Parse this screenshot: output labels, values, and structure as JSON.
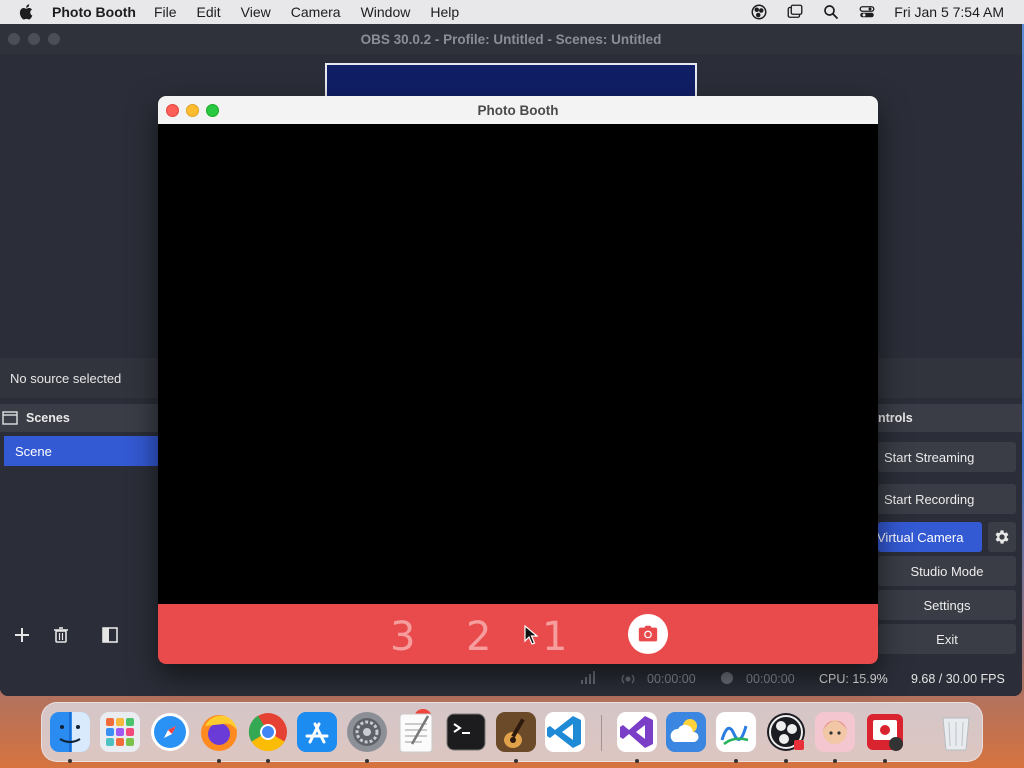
{
  "menubar": {
    "app_name": "Photo Booth",
    "items": [
      "File",
      "Edit",
      "View",
      "Camera",
      "Window",
      "Help"
    ],
    "datetime": "Fri Jan 5  7:54 AM"
  },
  "obs": {
    "title": "OBS 30.0.2 - Profile: Untitled - Scenes: Untitled",
    "no_source": "No source selected",
    "scenes_header": "Scenes",
    "scene_item": "Scene",
    "controls_header": "ntrols",
    "controls": {
      "start_streaming": "Start Streaming",
      "start_recording": "Start Recording",
      "virtual_camera": "Virtual Camera",
      "studio_mode": "Studio Mode",
      "settings": "Settings",
      "exit": "Exit"
    },
    "status": {
      "stream_time": "00:00:00",
      "record_time": "00:00:00",
      "cpu": "CPU: 15.9%",
      "fps": "9.68 / 30.00 FPS"
    }
  },
  "photobooth": {
    "title": "Photo Booth",
    "countdown": [
      "3",
      "2",
      "1"
    ]
  },
  "dock": {
    "apps": [
      "finder-icon",
      "launchpad-icon",
      "safari-icon",
      "firefox-icon",
      "chrome-icon",
      "app-store-icon",
      "system-settings-icon",
      "textedit-icon",
      "terminal-icon",
      "garageband-icon",
      "vscode-icon",
      "visual-studio-icon",
      "weather-icon",
      "freeform-icon",
      "obs-icon",
      "memoji-icon",
      "photo-booth-icon",
      "trash-icon"
    ],
    "settings_badge": "1"
  },
  "colors": {
    "obs_bg": "#2b2e38",
    "obs_accent": "#3359d3",
    "photobooth_red": "#e94a4c"
  }
}
